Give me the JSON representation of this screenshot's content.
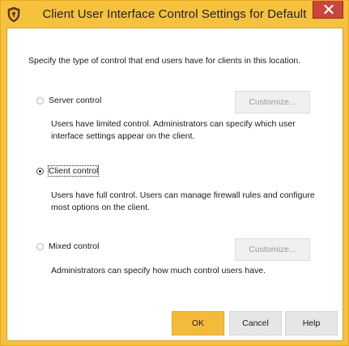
{
  "window": {
    "title": "Client User Interface Control Settings for Default"
  },
  "intro_text": "Specify the type of control that end users have for clients in this location.",
  "options": [
    {
      "label": "Server control",
      "selected": false,
      "customize_label": "Customize...",
      "customize_enabled": false,
      "description": "Users have limited control. Administrators can specify which user interface settings appear on the client."
    },
    {
      "label": "Client control",
      "selected": true,
      "description": "Users have full control. Users can manage firewall rules and configure most options on the client."
    },
    {
      "label": "Mixed control",
      "selected": false,
      "customize_label": "Customize...",
      "customize_enabled": false,
      "description": "Administrators can specify how much control users have."
    }
  ],
  "buttons": {
    "ok": "OK",
    "cancel": "Cancel",
    "help": "Help"
  },
  "icons": {
    "app": "shield-icon",
    "close": "close-icon"
  },
  "colors": {
    "accent": "#f6c23d",
    "ok_button": "#f6ba3a",
    "close_button": "#c9463d"
  }
}
